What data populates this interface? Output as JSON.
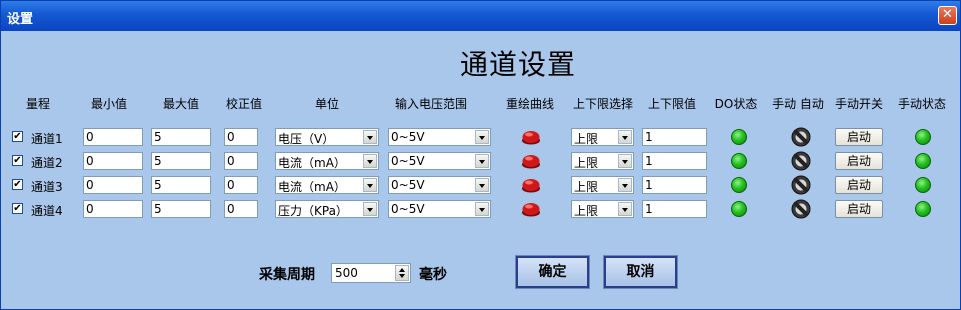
{
  "window": {
    "title": "设置",
    "close_label": "✕"
  },
  "heading": "通道设置",
  "columns": {
    "range": "量程",
    "min": "最小值",
    "max": "最大值",
    "calibration": "校正值",
    "unit": "单位",
    "input_voltage": "输入电压范围",
    "redraw": "重绘曲线",
    "limit_select": "上下限选择",
    "limit_value": "上下限值",
    "do_status": "DO状态",
    "manual_auto": "手动 自动",
    "manual_switch": "手动开关",
    "manual_status": "手动状态"
  },
  "channels": [
    {
      "label": "通道1",
      "checked": true,
      "min": "0",
      "max": "5",
      "cal": "0",
      "unit": "电压（V）",
      "range": "0~5V",
      "limit": "上限",
      "limit_value": "1",
      "start_label": "启动"
    },
    {
      "label": "通道2",
      "checked": true,
      "min": "0",
      "max": "5",
      "cal": "0",
      "unit": "电流（mA）",
      "range": "0~5V",
      "limit": "上限",
      "limit_value": "1",
      "start_label": "启动"
    },
    {
      "label": "通道3",
      "checked": true,
      "min": "0",
      "max": "5",
      "cal": "0",
      "unit": "电流（mA）",
      "range": "0~5V",
      "limit": "上限",
      "limit_value": "1",
      "start_label": "启动"
    },
    {
      "label": "通道4",
      "checked": true,
      "min": "0",
      "max": "5",
      "cal": "0",
      "unit": "压力（KPa）",
      "range": "0~5V",
      "limit": "上限",
      "limit_value": "1",
      "start_label": "启动"
    }
  ],
  "footer": {
    "period_label": "采集周期",
    "period_value": "500",
    "period_unit": "毫秒",
    "ok_label": "确定",
    "cancel_label": "取消"
  },
  "colors": {
    "background": "#a9c7ea",
    "titlebar": "#165bd4",
    "led_green": "#24c21e",
    "button_red": "#d01818"
  }
}
